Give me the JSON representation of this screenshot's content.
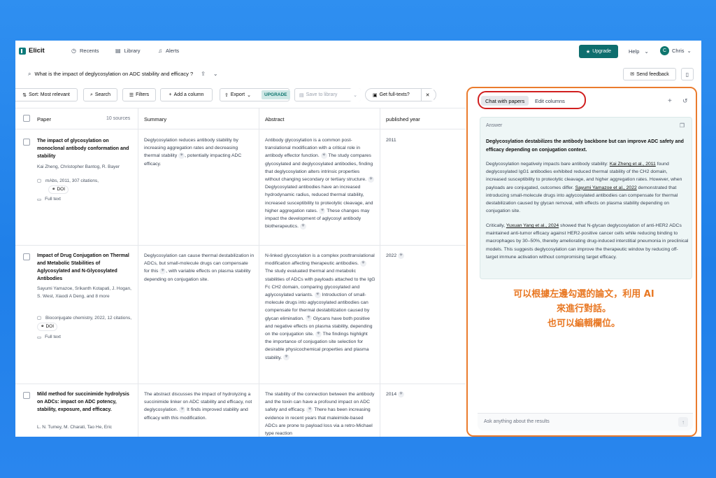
{
  "nav": {
    "logo": "Elicit",
    "recents": "Recents",
    "library": "Library",
    "alerts": "Alerts",
    "upgrade": "Upgrade",
    "help": "Help",
    "user_initial": "C",
    "user_name": "Chris"
  },
  "query": {
    "text": "What is the impact of deglycosylation on ADC stability and efficacy ?",
    "send_feedback": "Send feedback"
  },
  "toolbar": {
    "sort": "Sort: Most relevant",
    "search": "Search",
    "filters": "Filters",
    "add_column": "Add a column",
    "export": "Export",
    "upgrade_badge": "UPGRADE",
    "save_library": "Save to library",
    "get_fulltexts": "Get full-texts?"
  },
  "table": {
    "headers": {
      "paper": "Paper",
      "sources": "10 sources",
      "summary": "Summary",
      "abstract": "Abstract",
      "year": "published year"
    },
    "rows": [
      {
        "title": "The impact of glycosylation on monoclonal antibody conformation and stability",
        "authors": "Kai Zheng, Christopher Bantog, R. Bayer",
        "journal": "mAbs, 2011, 307 citations,",
        "doi": "DOI",
        "fulltext": "Full text",
        "summary_a": "Deglycosylation reduces antibody stability by increasing aggregation rates and decreasing thermal stability",
        "summary_b": ", potentially impacting ADC efficacy.",
        "abstract_a": "Antibody glycosylation is a common post-translational modification with a critical role in antibody effector function.",
        "abstract_b": "The study compares glycosylated and deglycosylated antibodies, finding that deglycosylation alters intrinsic properties without changing secondary or tertiary structure.",
        "abstract_c": "Deglycosylated antibodies have an increased hydrodynamic radius, reduced thermal stability, increased susceptibility to proteolytic cleavage, and higher aggregation rates.",
        "abstract_d": "These changes may impact the development of aglycosyl antibody biotherapeutics.",
        "year": "2011"
      },
      {
        "title": "Impact of Drug Conjugation on Thermal and Metabolic Stabilities of Aglycosylated and N-Glycosylated Antibodies",
        "authors": "Sayumi Yamazoe, Srikanth Kotapati, J. Hogan, S. West, Xiaodi A Deng, and 8 more",
        "journal": "Bioconjugate chemistry, 2022, 12 citations,",
        "doi": "DOI",
        "fulltext": "Full text",
        "summary_a": "Deglycosylation can cause thermal destabilization in ADCs, but small-molecule drugs can compensate for this",
        "summary_b": ", with variable effects on plasma stability depending on conjugation site.",
        "abstract_a": "N-linked glycosylation is a complex posttranslational modification affecting therapeutic antibodies.",
        "abstract_b": "The study evaluated thermal and metabolic stabilities of ADCs with payloads attached to the IgG Fc CH2 domain, comparing glycosylated and aglycosylated variants.",
        "abstract_c": "Introduction of small-molecule drugs into aglycosylated antibodies can compensate for thermal destabilization caused by glycan elimination.",
        "abstract_d": "Glycans have both positive and negative effects on plasma stability, depending on the conjugation site.",
        "abstract_e": "The findings highlight the importance of conjugation site selection for desirable physicochemical properties and plasma stability.",
        "year": "2022"
      },
      {
        "title": "Mild method for succinimide hydrolysis on ADCs: impact on ADC potency, stability, exposure, and efficacy.",
        "authors": "L. N. Tumey, M. Charati, Tao He, Eric",
        "summary_a": "The abstract discusses the impact of hydrolyzing a succinimide linker on ADC stability and efficacy, not deglycosylation.",
        "summary_b": "It finds improved stability and efficacy with this modification.",
        "abstract_a": "The stability of the connection between the antibody and the toxin can have a profound impact on ADC safety and efficacy.",
        "abstract_b": "There has been increasing evidence in recent years that maleimide-based ADCs are prone to payload loss via a retro-Michael type reaction",
        "year": "2014"
      }
    ]
  },
  "panel": {
    "tab_chat": "Chat with papers",
    "tab_edit": "Edit columns",
    "answer_label": "Answer",
    "answer_title": "Deglycosylation destabilizes the antibody backbone but can improve ADC safety and efficacy depending on conjugation context.",
    "p1_a": "Deglycosylation negatively impacts bare antibody stability:",
    "p1_cite1": "Kai Zheng et al., 2011",
    "p1_b": "found deglycosylated IgG1 antibodies exhibited reduced thermal stability of the CH2 domain, increased susceptibility to proteolytic cleavage, and higher aggregation rates. However, when payloads are conjugated, outcomes differ.",
    "p1_cite2": "Sayumi Yamazoe et al., 2022",
    "p1_c": "demonstrated that introducing small-molecule drugs into aglycosylated antibodies can compensate for thermal destabilization caused by glycan removal, with effects on plasma stability depending on conjugation site.",
    "p2_a": "Critically,",
    "p2_cite": "Yuxuan Yang et al., 2024",
    "p2_b": "showed that N-glycan deglycosylation of anti-HER2 ADCs maintained anti-tumor efficacy against HER2-positive cancer cells while reducing binding to macrophages by 30–50%, thereby ameliorating drug-induced interstitial pneumonia in preclinical models. This suggests deglycosylation can improve the therapeutic window by reducing off-target immune activation without compromising target efficacy.",
    "annotation_1": "可以根據左邊勾選的論文，利用 AI",
    "annotation_2": "來進行對話。",
    "annotation_3": "也可以編輯欄位。",
    "ask_placeholder": "Ask anything about the results"
  },
  "colors": {
    "accent": "#0e6e6e",
    "annotation": "#e87722",
    "highlight_box": "#ea7b2d",
    "tab_circle": "#d11f1f"
  }
}
